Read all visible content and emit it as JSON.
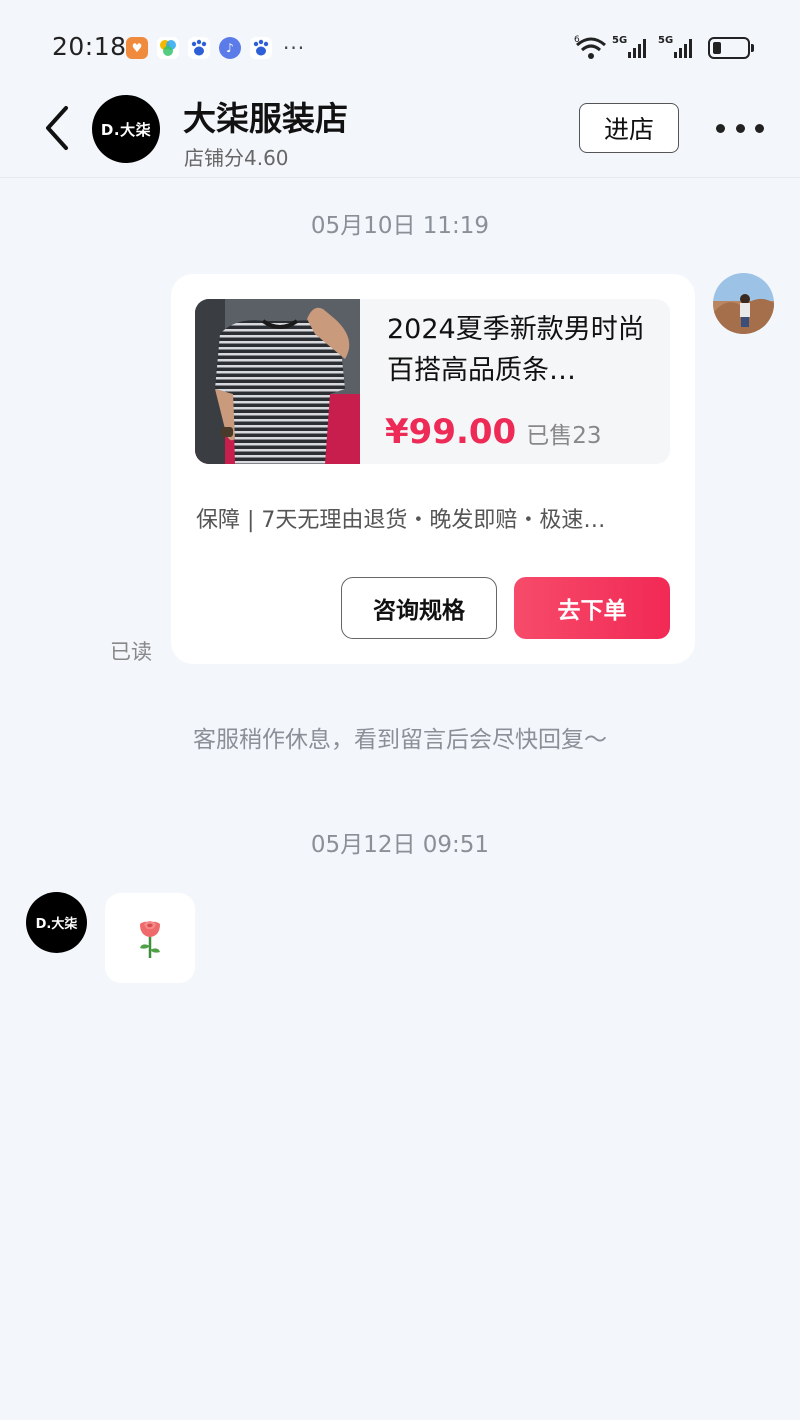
{
  "status_bar": {
    "time": "20:18",
    "more": "···",
    "app_icons": [
      "orange-heart-icon",
      "colorful-app-icon",
      "baidu-icon",
      "music-icon",
      "baidu-icon"
    ],
    "indicators": [
      "wifi-icon",
      "5g-signal-icon",
      "5g-signal-icon",
      "battery-icon"
    ],
    "battery_level": 0.25
  },
  "header": {
    "shop_avatar_text": "D.大柒",
    "shop_name": "大柒服装店",
    "shop_score": "店铺分4.60",
    "enter_label": "进店"
  },
  "messages": {
    "date1": "05月10日 11:19",
    "product": {
      "title": "2024夏季新款男时尚百搭高品质条…",
      "price": "¥99.00",
      "sold": "已售23",
      "guarantee": "保障 | 7天无理由退货・晚发即赔・极速…",
      "consult_label": "咨询规格",
      "order_label": "去下单"
    },
    "read_label": "已读",
    "system_text": "客服稍作休息，看到留言后会尽快回复～",
    "date2": "05月12日 09:51",
    "reply_avatar_text": "D.大柒",
    "reply_emoji": "🌹"
  },
  "colors": {
    "background": "#f3f6fb",
    "price": "#ee2a56",
    "order_button": "#f12955"
  }
}
